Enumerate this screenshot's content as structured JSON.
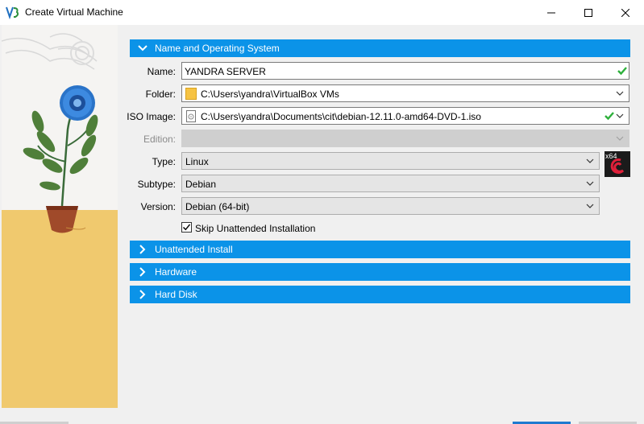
{
  "window": {
    "title": "Create Virtual Machine"
  },
  "icons": {
    "app": "virtualbox-app-icon",
    "minimize": "minimize-icon",
    "maximize": "maximize-icon",
    "close": "close-icon",
    "os": "debian-64-os-icon"
  },
  "colors": {
    "section_header": "#0b93e8",
    "valid_check": "#2db03b",
    "folder": "#f6c343"
  },
  "sections": {
    "name_os": "Name and Operating System",
    "unattended": "Unattended Install",
    "hardware": "Hardware",
    "hard_disk": "Hard Disk"
  },
  "form": {
    "name": {
      "label": "Name:",
      "value": "YANDRA SERVER"
    },
    "folder": {
      "label": "Folder:",
      "value": "C:\\Users\\yandra\\VirtualBox VMs"
    },
    "iso": {
      "label": "ISO Image:",
      "value": "C:\\Users\\yandra\\Documents\\cit\\debian-12.11.0-amd64-DVD-1.iso"
    },
    "edition": {
      "label": "Edition:",
      "value": ""
    },
    "type": {
      "label": "Type:",
      "value": "Linux"
    },
    "subtype": {
      "label": "Subtype:",
      "value": "Debian"
    },
    "version": {
      "label": "Version:",
      "value": "Debian (64-bit)"
    },
    "skip_unattended": {
      "label": "Skip Unattended Installation",
      "checked": true
    },
    "os_badge": "x64"
  }
}
